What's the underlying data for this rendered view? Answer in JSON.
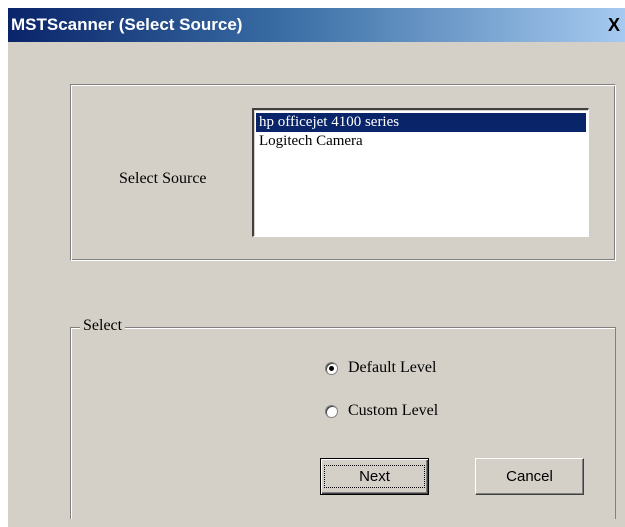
{
  "window": {
    "title": "MSTScanner (Select Source)",
    "close_label": "X"
  },
  "source": {
    "label": "Select Source",
    "items": [
      {
        "label": "hp officejet 4100 series",
        "selected": true
      },
      {
        "label": "Logitech Camera",
        "selected": false
      }
    ]
  },
  "select_group": {
    "legend": "Select",
    "options": [
      {
        "label": "Default Level",
        "checked": true
      },
      {
        "label": "Custom Level",
        "checked": false
      }
    ]
  },
  "buttons": {
    "next_label": "Next",
    "cancel_label": "Cancel"
  },
  "colors": {
    "titlebar_start": "#0a246a",
    "titlebar_end": "#a6caf0",
    "dialog_face": "#d4d0c8",
    "selection": "#0a246a"
  }
}
